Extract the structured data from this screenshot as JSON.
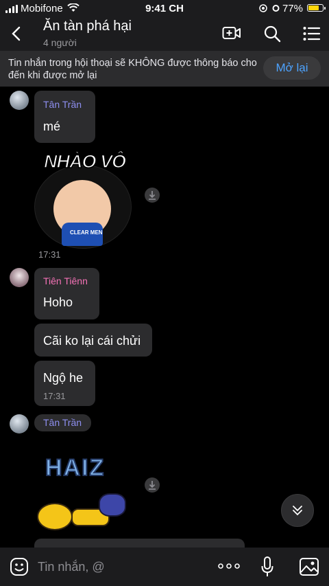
{
  "status": {
    "carrier": "Mobifone",
    "time": "9:41 CH",
    "battery": "77%",
    "battery_level": 0.77
  },
  "header": {
    "title": "Ăn tàn phá hại",
    "subtitle": "4 người"
  },
  "notice": {
    "text": "Tin nhắn trong hội thoại sẽ KHÔNG được thông báo cho đến khi được mở lại",
    "button": "Mở lại"
  },
  "messages": [
    {
      "sender": "Tân Trần",
      "sender_color": "#8e8ff0",
      "text": "mé"
    },
    {
      "sticker": "NHÀO VÔ",
      "sticker_sub": "CLEAR MEN",
      "time": "17:31"
    },
    {
      "sender": "Tiên Tiênn",
      "sender_color": "#f472b6",
      "text": "Hoho"
    },
    {
      "text": "Cãi ko lại cái chửi"
    },
    {
      "text": "Ngộ he",
      "time": "17:31"
    },
    {
      "sender": "Tân Trần",
      "sender_color": "#8e8ff0"
    },
    {
      "sticker": "HAIZ"
    }
  ],
  "input": {
    "placeholder": "Tin nhắn, @"
  },
  "icons": [
    "back-icon",
    "video-call-icon",
    "search-icon",
    "menu-icon",
    "download-icon",
    "scroll-down-icon",
    "emoji-icon",
    "more-icon",
    "mic-icon",
    "image-icon"
  ]
}
